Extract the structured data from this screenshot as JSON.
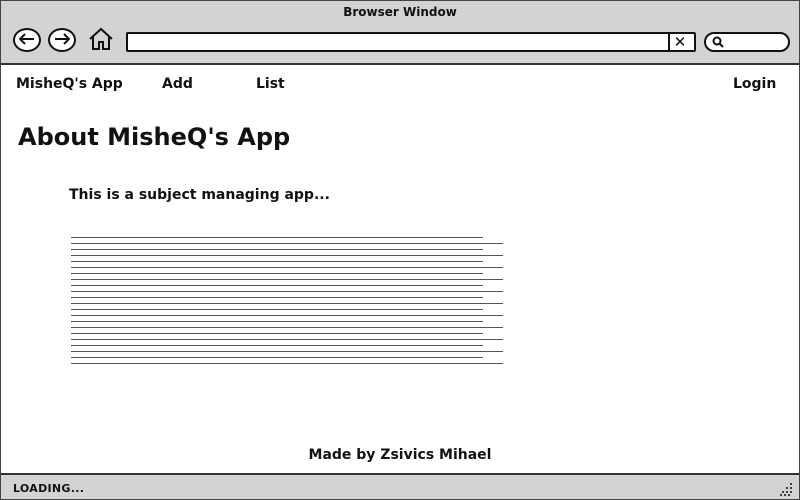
{
  "window": {
    "title": "Browser Window",
    "status": "LOADING..."
  },
  "nav": {
    "brand": "MisheQ's App",
    "add": "Add",
    "list": "List",
    "login": "Login"
  },
  "main": {
    "title": "About MisheQ's App",
    "subtitle": "This is a subject managing app...",
    "paragraph_line_count": 22
  },
  "footer": {
    "credit": "Made by Zsivics Mihael"
  },
  "icons": {
    "back": "back-arrow-icon",
    "forward": "forward-arrow-icon",
    "home": "home-icon",
    "clear": "close-icon",
    "search": "search-icon",
    "resize": "resize-grip-icon"
  }
}
